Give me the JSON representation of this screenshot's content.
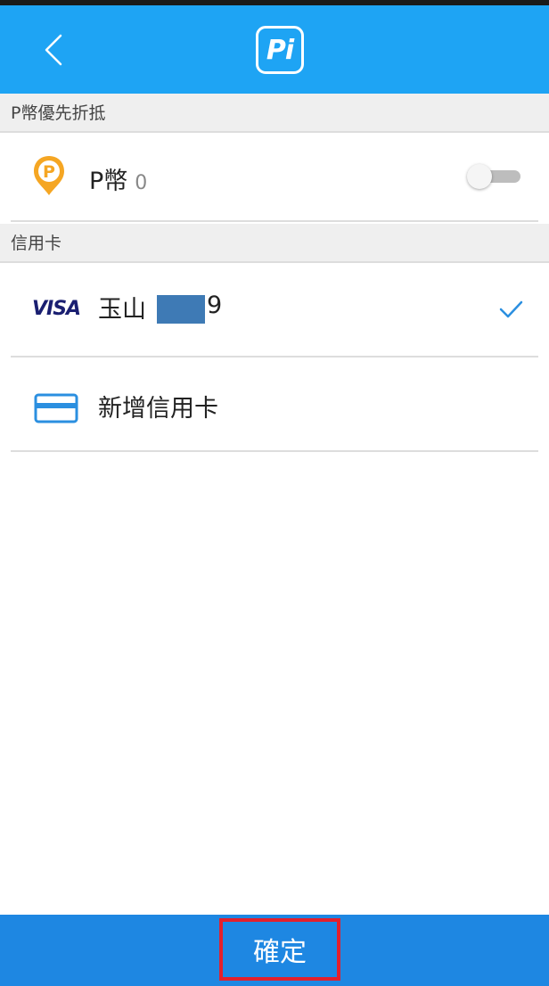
{
  "header": {
    "back_icon": "chevron-left-icon",
    "logo_text": "Pi"
  },
  "sections": {
    "pcoin_header": "P幣優先折抵",
    "credit_header": "信用卡"
  },
  "pcoin": {
    "icon": "pcoin-icon",
    "label": "P幣",
    "balance": "0",
    "toggle_on": false
  },
  "card": {
    "brand": "VISA",
    "bank": "玉山",
    "last_digit": "9",
    "selected": true
  },
  "add_card": {
    "icon": "credit-card-icon",
    "label": "新增信用卡"
  },
  "footer": {
    "confirm_label": "確定"
  },
  "colors": {
    "header_bg": "#1ea4f4",
    "footer_bg": "#1e87e2",
    "section_bg": "#efefef",
    "pcoin_orange": "#f5a623",
    "check_blue": "#2b8fe0",
    "visa_navy": "#1a1f71",
    "highlight_red": "#e3202d"
  }
}
